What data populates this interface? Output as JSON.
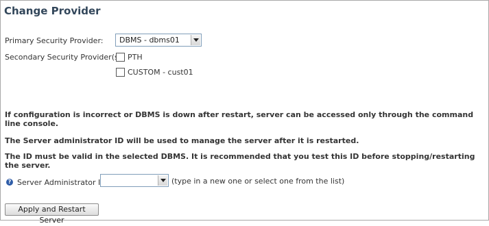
{
  "page": {
    "title": "Change Provider"
  },
  "primary": {
    "label": "Primary Security Provider:",
    "selected": "DBMS - dbms01"
  },
  "secondary": {
    "label": "Secondary Security Provider(s):",
    "options": [
      {
        "label": "PTH",
        "checked": false
      },
      {
        "label": "CUSTOM - cust01",
        "checked": false
      }
    ]
  },
  "notes": {
    "warning": "If configuration is incorrect or DBMS is down after restart, server can be accessed only through the command line console.",
    "admin_line1": "The Server administrator ID will be used to manage the server after it is restarted.",
    "admin_line2": "The ID must be valid in the selected DBMS.  It is recommended that you test this ID before stopping/restarting the server."
  },
  "admin": {
    "label": "Server Administrator ID",
    "value": "",
    "hint": "(type in a new one or select one from the list)",
    "icon": "help-icon"
  },
  "actions": {
    "apply_label": "Apply and Restart Server"
  }
}
